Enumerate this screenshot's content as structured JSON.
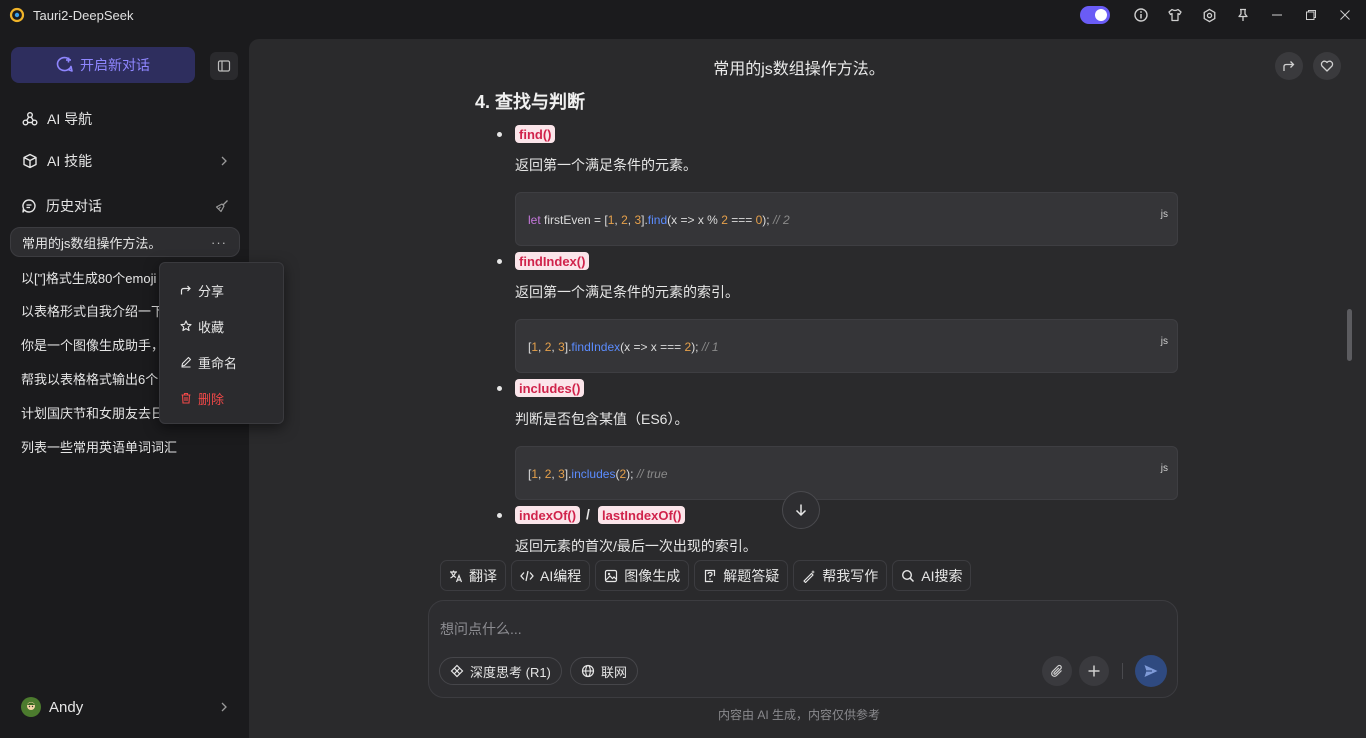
{
  "app": {
    "title": "Tauri2-DeepSeek"
  },
  "titlebar": {
    "icons": [
      "theme-toggle-icon",
      "info-icon",
      "shirt-icon",
      "settings-icon",
      "pin-icon",
      "minimize-icon",
      "restore-icon",
      "close-icon"
    ]
  },
  "sidebar": {
    "new_chat": "开启新对话",
    "nav": [
      {
        "label": "AI 导航"
      },
      {
        "label": "AI 技能"
      }
    ],
    "history_title": "历史对话",
    "history": [
      "常用的js数组操作方法。",
      "以[\"]格式生成80个emoji",
      "以表格形式自我介绍一下",
      "你是一个图像生成助手，",
      "帮我以表格格式输出6个",
      "计划国庆节和女朋友去日",
      "列表一些常用英语单词词汇"
    ],
    "context_menu": [
      "分享",
      "收藏",
      "重命名",
      "删除"
    ],
    "user": "Andy"
  },
  "main": {
    "title": "常用的js数组操作方法。",
    "section_title": "4. 查找与判断",
    "items": [
      {
        "name": "find()",
        "desc": "返回第一个满足条件的元素。"
      },
      {
        "name": "findIndex()",
        "desc": "返回第一个满足条件的元素的索引。"
      },
      {
        "name": "includes()",
        "desc": "判断是否包含某值（ES6）。"
      },
      {
        "name": "indexOf()",
        "name2": "lastIndexOf()",
        "sep": "/",
        "desc": "返回元素的首次/最后一次出现的索引。"
      }
    ],
    "code_lang": "js",
    "code": [
      {
        "t1": "let",
        "t2": " firstEven = [",
        "n1": "1",
        "t3": ", ",
        "n2": "2",
        "t4": ", ",
        "n3": "3",
        "t5": "].",
        "fn": "find",
        "t6": "(x => x % ",
        "n4": "2",
        "t7": " === ",
        "n5": "0",
        "t8": "); ",
        "cm": "// 2"
      },
      {
        "t1": "[",
        "n1": "1",
        "t2": ", ",
        "n2": "2",
        "t3": ", ",
        "n3": "3",
        "t4": "].",
        "fn": "findIndex",
        "t5": "(x => x === ",
        "n4": "2",
        "t6": "); ",
        "cm": "// 1"
      },
      {
        "t1": "[",
        "n1": "1",
        "t2": ", ",
        "n2": "2",
        "t3": ", ",
        "n3": "3",
        "t4": "].",
        "fn": "includes",
        "t5": "(",
        "n4": "2",
        "t6": "); ",
        "cm": "// true"
      }
    ],
    "tools": [
      "翻译",
      "AI编程",
      "图像生成",
      "解题答疑",
      "帮我写作",
      "AI搜索"
    ],
    "input_placeholder": "想问点什么...",
    "deep_think": "深度思考 (R1)",
    "web": "联网",
    "footer": "内容由 AI 生成，内容仅供参考"
  }
}
